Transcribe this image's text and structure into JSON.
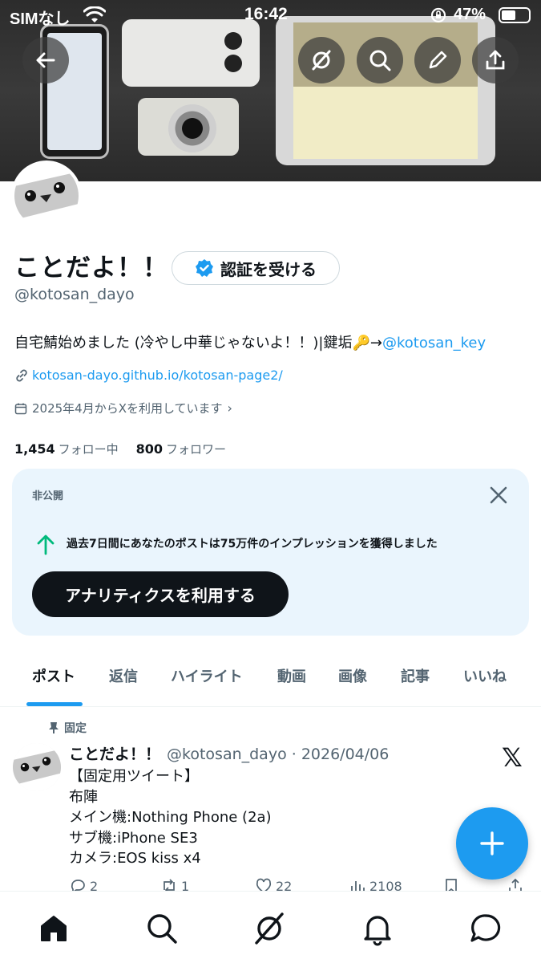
{
  "status_bar": {
    "carrier": "SIMなし",
    "time": "16:42",
    "battery": "47%"
  },
  "header_buttons": [
    "back-icon",
    "grok-icon",
    "search-icon",
    "edit-icon",
    "share-icon"
  ],
  "profile": {
    "name": "ことだよ！！",
    "verify_label": "認証を受ける",
    "handle": "@kotosan_dayo",
    "bio_text": "自宅鯖始めました (冷やし中華じゃないよ！！)|鍵垢🔑→",
    "bio_link": "@kotosan_key",
    "website": "kotosan-dayo.github.io/kotosan-page2/",
    "joined": "2025年4月からXを利用しています",
    "following_count": "1,454",
    "following_label": "フォロー中",
    "followers_count": "800",
    "followers_label": "フォロワー"
  },
  "private_card": {
    "label": "非公開",
    "message": "過去7日間にあなたのポストは75万件のインプレッションを獲得しました",
    "cta": "アナリティクスを利用する"
  },
  "tabs": [
    "ポスト",
    "返信",
    "ハイライト",
    "動画",
    "画像",
    "記事",
    "いいね"
  ],
  "active_tab": "ポスト",
  "post": {
    "pinned_label": "固定",
    "name": "ことだよ！！",
    "meta": "@kotosan_dayo · 2026/04/06",
    "lines": [
      "【固定用ツイート】",
      "布陣",
      "メイン機:Nothing Phone (2a)",
      "サブ機:iPhone SE3",
      "カメラ:EOS kiss x4"
    ],
    "replies": "2",
    "reposts": "1",
    "likes": "22",
    "views": "2108"
  },
  "colors": {
    "accent": "#1d9bf0",
    "text": "#0f1419",
    "muted": "#536471",
    "card_bg": "#eaf5fd"
  }
}
